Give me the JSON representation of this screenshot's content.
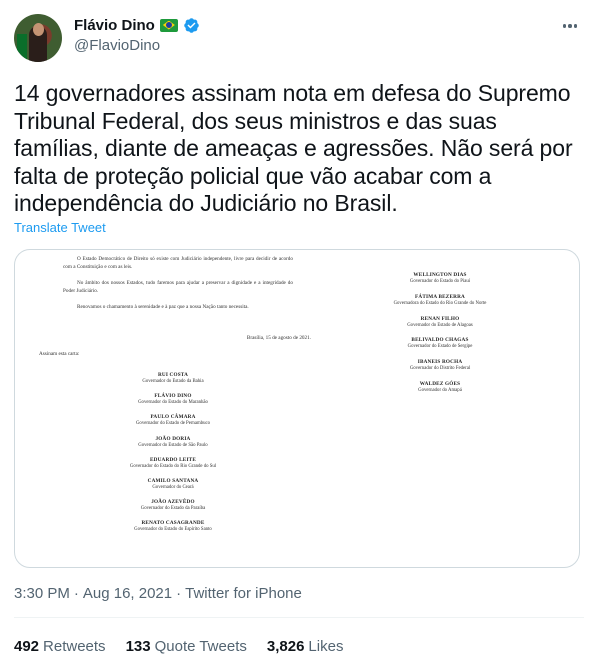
{
  "author": {
    "display_name": "Flávio Dino",
    "handle": "@FlavioDino",
    "flag_icon": "brazil-flag-emoji",
    "verified_icon": "verified-badge-icon"
  },
  "tweet": {
    "text_lines": [
      "14 governadores assinam nota em defesa do Supremo",
      "Tribunal Federal, dos seus ministros e das suas",
      "famílias, diante de ameaças e agressões. Não será por",
      "falta de proteção policial que vão acabar com a",
      "independência do Judiciário no Brasil."
    ],
    "translate_label": "Translate Tweet"
  },
  "document": {
    "paragraphs": [
      "O Estado Democrático de Direito só existe com Judiciário independente, livre",
      "para decidir de acordo com a Constituição e com as leis.",
      "No âmbito dos nossos Estados, tudo faremos para ajudar a preservar a",
      "dignidade e a integridade do Poder Judiciário.",
      "Renovamos o chamamento à serenidade e à paz que a nossa Nação tanto",
      "necessita."
    ],
    "date": "Brasília, 15 de agosto de 2021.",
    "sign_intro": "Assinam esta carta:",
    "signatories_left": [
      {
        "name": "RUI COSTA",
        "title": "Governador do Estado da Bahia"
      },
      {
        "name": "FLÁVIO DINO",
        "title": "Governador do Estado do Maranhão"
      },
      {
        "name": "PAULO CÂMARA",
        "title": "Governador do Estado de Pernambuco"
      },
      {
        "name": "JOÃO DORIA",
        "title": "Governador do Estado de São Paulo"
      },
      {
        "name": "EDUARDO LEITE",
        "title": "Governador do Estado do Rio Grande do Sul"
      },
      {
        "name": "CAMILO SANTANA",
        "title": "Governador do Ceará"
      },
      {
        "name": "JOÃO AZEVÊDO",
        "title": "Governador do Estado da Paraíba"
      },
      {
        "name": "RENATO CASAGRANDE",
        "title": "Governador do Estado do Espírito Santo"
      }
    ],
    "signatories_right": [
      {
        "name": "WELLINGTON DIAS",
        "title": "Governador do Estado do Piauí"
      },
      {
        "name": "FÁTIMA BEZERRA",
        "title": "Governadora do Estado do Rio Grande do Norte"
      },
      {
        "name": "RENAN FILHO",
        "title": "Governador do Estado de Alagoas"
      },
      {
        "name": "BELIVALDO CHAGAS",
        "title": "Governador do Estado de Sergipe"
      },
      {
        "name": "IBANEIS ROCHA",
        "title": "Governador do Distrito Federal"
      },
      {
        "name": "WALDEZ GÓES",
        "title": "Governador do Amapá"
      }
    ]
  },
  "meta": {
    "time": "3:30 PM",
    "separator": "·",
    "date": "Aug 16, 2021",
    "source": "Twitter for iPhone"
  },
  "stats": {
    "retweets_count": "492",
    "retweets_label": "Retweets",
    "quotes_count": "133",
    "quotes_label": "Quote Tweets",
    "likes_count": "3,826",
    "likes_label": "Likes"
  },
  "colors": {
    "link_blue": "#1d9bf0",
    "text_primary": "#0f1419",
    "text_secondary": "#536471",
    "border": "#cfd9de"
  }
}
